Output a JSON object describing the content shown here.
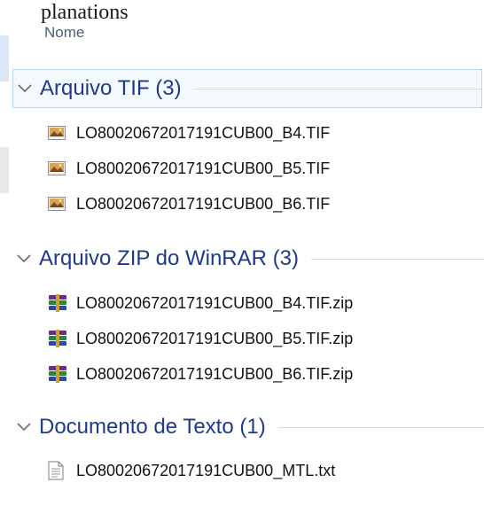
{
  "caption": "planations",
  "column_header": "Nome",
  "groups": [
    {
      "title": "Arquivo TIF (3)",
      "icon": "tif-image-icon",
      "files": [
        "LO80020672017191CUB00_B4.TIF",
        "LO80020672017191CUB00_B5.TIF",
        "LO80020672017191CUB00_B6.TIF"
      ]
    },
    {
      "title": "Arquivo ZIP do WinRAR (3)",
      "icon": "winrar-archive-icon",
      "files": [
        "LO80020672017191CUB00_B4.TIF.zip",
        "LO80020672017191CUB00_B5.TIF.zip",
        "LO80020672017191CUB00_B6.TIF.zip"
      ]
    },
    {
      "title": "Documento de Texto (1)",
      "icon": "text-document-icon",
      "files": [
        "LO80020672017191CUB00_MTL.txt"
      ]
    }
  ]
}
